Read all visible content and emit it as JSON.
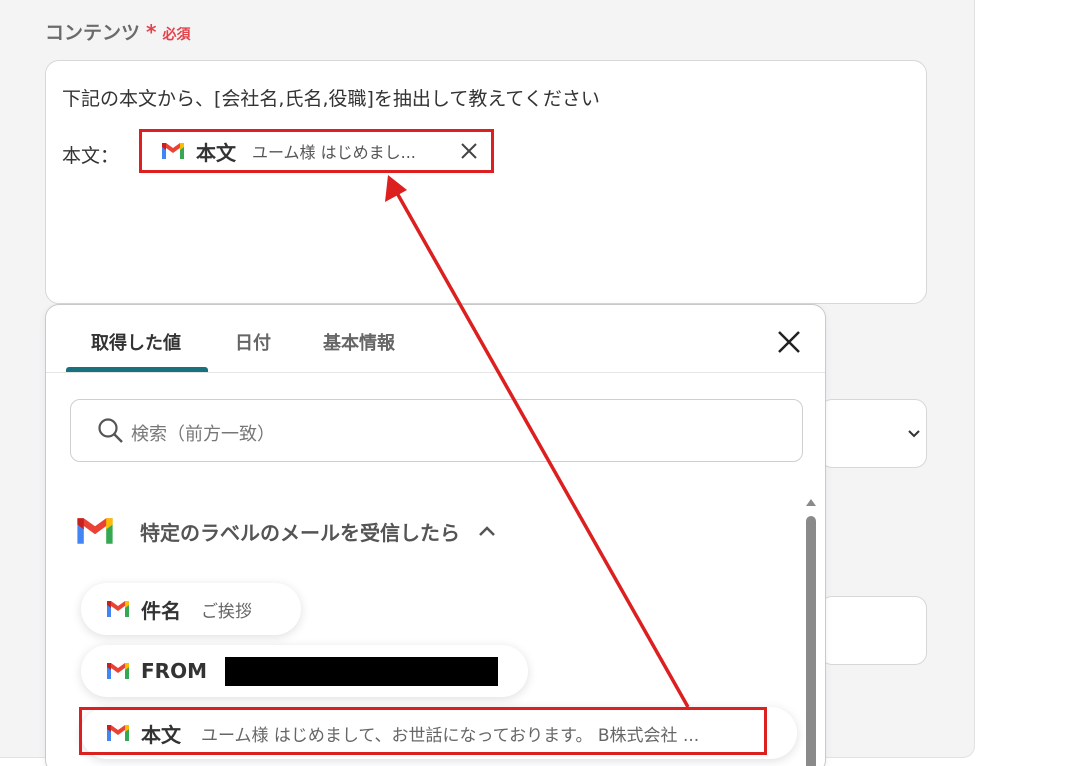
{
  "content_field": {
    "label": "コンテンツ",
    "required_star": "*",
    "required_text": "必須",
    "prompt_line": "下記の本文から、[会社名,氏名,役職]を抽出して教えてください",
    "body_prefix": "本文：",
    "chip": {
      "label": "本文",
      "value": "ユーム様 はじめまし..."
    }
  },
  "popup": {
    "tabs": [
      {
        "label": "取得した値",
        "active": true
      },
      {
        "label": "日付",
        "active": false
      },
      {
        "label": "基本情報",
        "active": false
      }
    ],
    "search_placeholder": "検索（前方一致）",
    "section_title": "特定のラベルのメールを受信したら",
    "items": [
      {
        "label": "件名",
        "value": "ご挨拶"
      },
      {
        "label": "FROM",
        "value": ""
      },
      {
        "label": "本文",
        "value": "ユーム様 はじめまして、お世話になっております。 B株式会社 ..."
      }
    ]
  },
  "icons": {
    "gmail": "gmail-icon",
    "close": "close-icon",
    "search": "search-icon",
    "chevron_up": "chevron-up-icon",
    "chevron_down": "chevron-down-icon"
  },
  "colors": {
    "highlight_red": "#dc1f1f",
    "tab_accent": "#17727e",
    "required": "#e4424b"
  }
}
